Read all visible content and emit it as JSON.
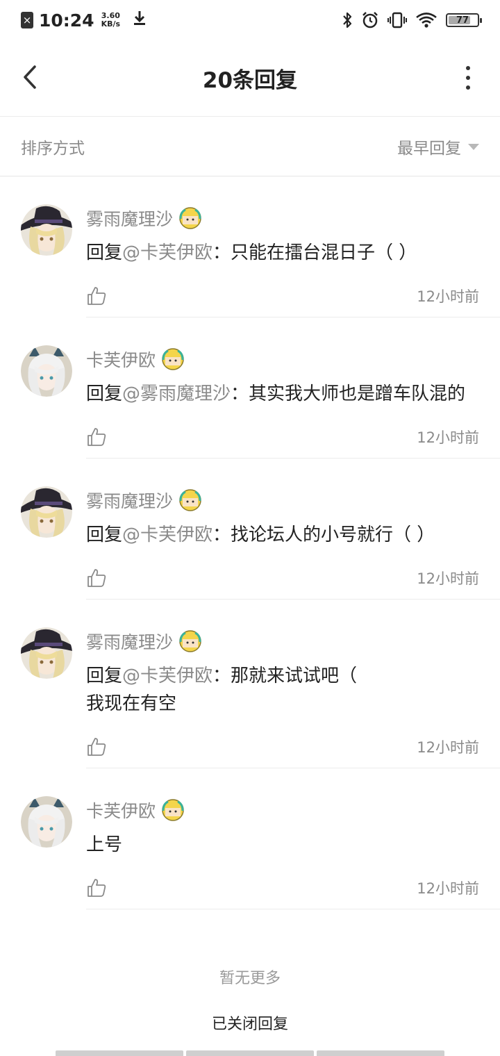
{
  "status_bar": {
    "time": "10:24",
    "net_speed_value": "3.60",
    "net_speed_unit": "KB/s",
    "battery_level": "77",
    "battery_fraction": 0.77,
    "icons": [
      "sim-off-icon",
      "download-icon",
      "bluetooth-icon",
      "alarm-icon",
      "vibrate-icon",
      "wifi-icon",
      "battery-icon"
    ]
  },
  "nav": {
    "title": "20条回复",
    "back_icon": "chevron-left-icon",
    "more_icon": "more-vertical-icon"
  },
  "sort": {
    "label": "排序方式",
    "value": "最早回复"
  },
  "replies": [
    {
      "name": "雾雨魔理沙",
      "avatar": "witch-girl",
      "prefix": "回复",
      "mention": "@卡芙伊欧",
      "text": "：只能在擂台混日子（ ）",
      "time": "12小时前"
    },
    {
      "name": "卡芙伊欧",
      "avatar": "silver-cat-girl",
      "prefix": "回复",
      "mention": "@雾雨魔理沙",
      "text": "：其实我大师也是蹭车队混的",
      "time": "12小时前"
    },
    {
      "name": "雾雨魔理沙",
      "avatar": "witch-girl",
      "prefix": "回复",
      "mention": "@卡芙伊欧",
      "text": "：找论坛人的小号就行（ ）",
      "time": "12小时前"
    },
    {
      "name": "雾雨魔理沙",
      "avatar": "witch-girl",
      "prefix": "回复",
      "mention": "@卡芙伊欧",
      "text": "：那就来试试吧（\n我现在有空",
      "time": "12小时前"
    },
    {
      "name": "卡芙伊欧",
      "avatar": "silver-cat-girl",
      "prefix": "",
      "mention": "",
      "text": "上号",
      "time": "12小时前"
    }
  ],
  "footer": {
    "end_text": "暂无更多",
    "closed_text": "已关闭回复"
  },
  "colors": {
    "secondary_text": "#8a8a8a",
    "primary_text": "#222222",
    "divider": "#ececec"
  }
}
